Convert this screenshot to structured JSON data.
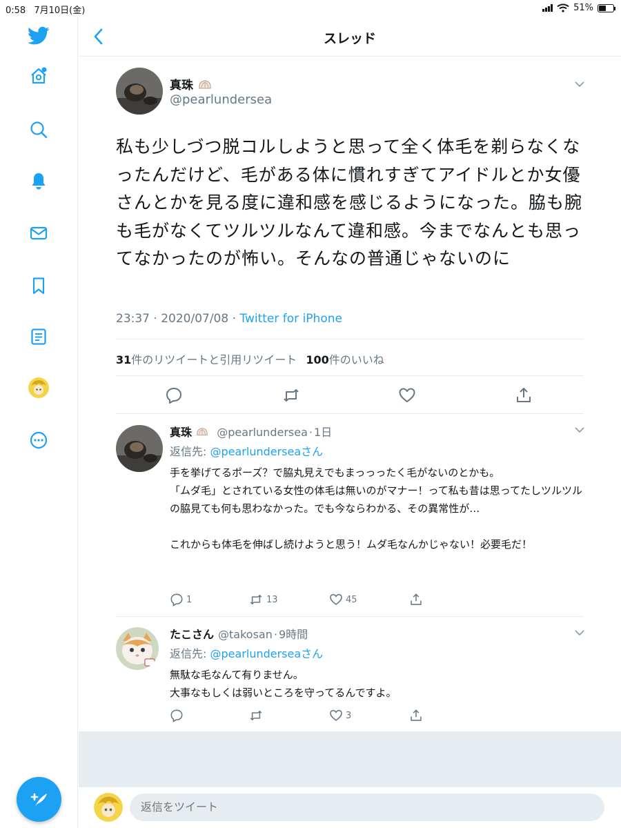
{
  "status_bar": {
    "time": "0:58",
    "date": "7月10日(金)",
    "battery": "51%",
    "battery_level": 0.51
  },
  "header": {
    "title": "スレッド"
  },
  "composer": {
    "placeholder": "返信をツイート"
  },
  "main_tweet": {
    "name": "真珠",
    "handle": "@pearlundersea",
    "text": "私も少しづつ脱コルしようと思って全く体毛を剃らなくなったんだけど、毛がある体に慣れすぎてアイドルとか女優さんとかを見る度に違和感を感じるようになった。脇も腕も毛がなくてツルツルなんて違和感。今までなんとも思ってなかったのが怖い。そんなの普通じゃないのに",
    "time": "23:37 · 2020/07/08 · ",
    "source": "Twitter for iPhone",
    "retweets": "31",
    "retweets_label": "件のリツイートと引用リツイート",
    "likes": "100",
    "likes_label": "件のいいね"
  },
  "replies": [
    {
      "name": "真珠",
      "handle": "@pearlundersea",
      "time": "1日",
      "reply_to_label": "返信先: ",
      "reply_to_mention": "@pearlunderseaさん",
      "text": "手を挙げてるポーズ？で脇丸見えでもまっっったく毛がないのとかも。\n「ムダ毛」とされている女性の体毛は無いのがマナー！って私も昔は思ってたしツルツルの脇見ても何も思わなかった。でも今ならわかる、その異常性が…\n\nこれからも体毛を伸ばし続けようと思う！ムダ毛なんかじゃない！必要毛だ！",
      "replies": "1",
      "retweets": "13",
      "likes": "45"
    },
    {
      "name": "たこさん",
      "handle": "@takosan",
      "time": "9時間",
      "reply_to_label": "返信先: ",
      "reply_to_mention": "@pearlunderseaさん",
      "text": "無駄な毛なんて有りません。\n大事なもしくは弱いところを守ってるんですよ。",
      "replies": "",
      "retweets": "",
      "likes": "3"
    }
  ],
  "icons": [
    "twitter-logo-icon",
    "home-icon",
    "search-icon",
    "notifications-icon",
    "messages-icon",
    "bookmarks-icon",
    "lists-icon",
    "profile-avatar",
    "more-icon",
    "compose-icon"
  ],
  "colors": {
    "accent": "#1da1f2",
    "secondary_text": "#657786",
    "divider": "#e6ecf0"
  }
}
